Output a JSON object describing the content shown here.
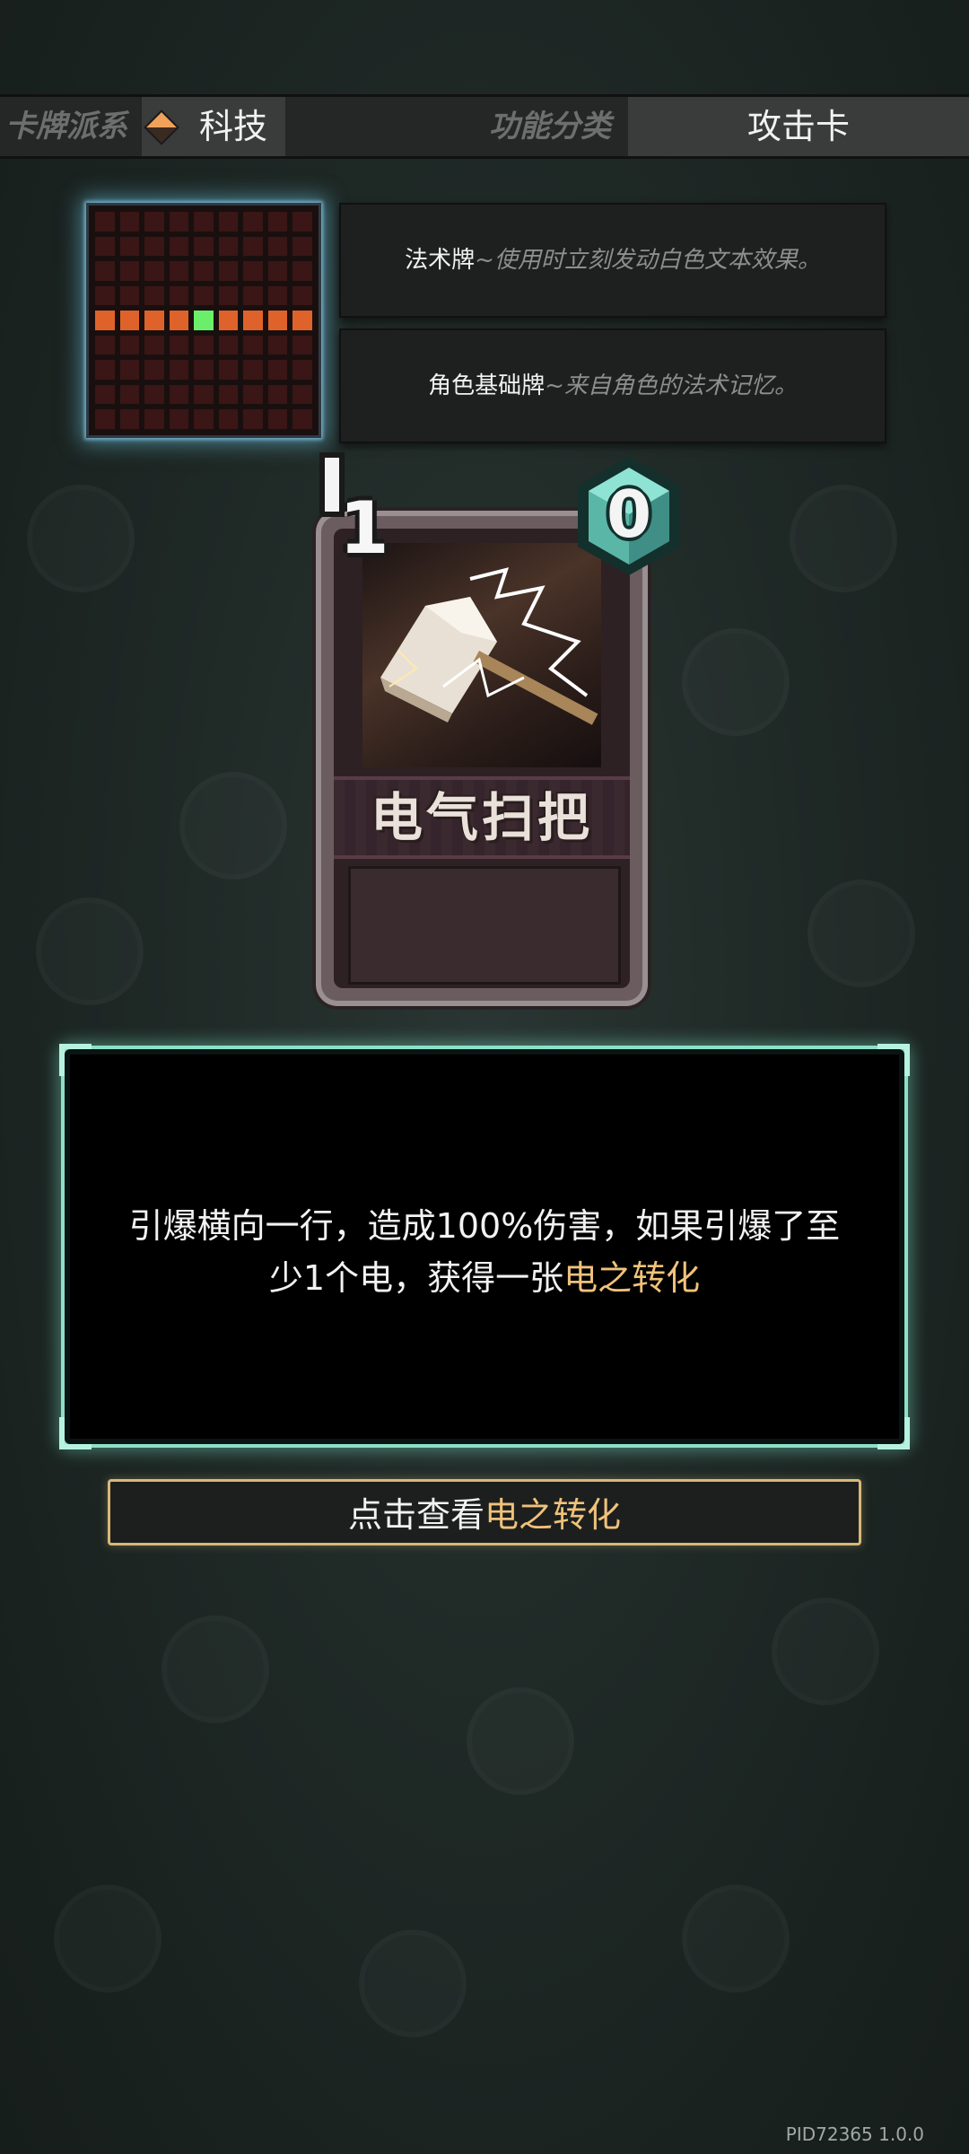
{
  "topbar": {
    "deck_label": "卡牌派系",
    "deck_value": "科技",
    "func_label": "功能分类",
    "func_value": "攻击卡"
  },
  "pattern": {
    "rows": 9,
    "cols": 9,
    "highlight_row": 4,
    "green_col": 4,
    "colors": {
      "empty": "#3a1616",
      "orange": "#e0622b",
      "green": "#6bef6b"
    }
  },
  "info": [
    {
      "key": "法术牌",
      "desc": "~使用时立刻发动白色文本效果。"
    },
    {
      "key": "角色基础牌",
      "desc": "~来自角色的法术记忆。"
    }
  ],
  "card": {
    "name": "电气扫把",
    "left_value": "1",
    "cost": "0"
  },
  "description": {
    "line1": "引爆横向一行，造成100%伤害，如果引爆了至",
    "line2_prefix": "少1个电，获得一张",
    "line2_highlight": "电之转化"
  },
  "view_button": {
    "prefix": "点击查看",
    "highlight": "电之转化"
  },
  "version": "PID72365 1.0.0",
  "colors": {
    "accent_teal": "#8de0c8",
    "highlight_gold": "#f0c27a",
    "grid_glow": "#6ec8e6"
  }
}
